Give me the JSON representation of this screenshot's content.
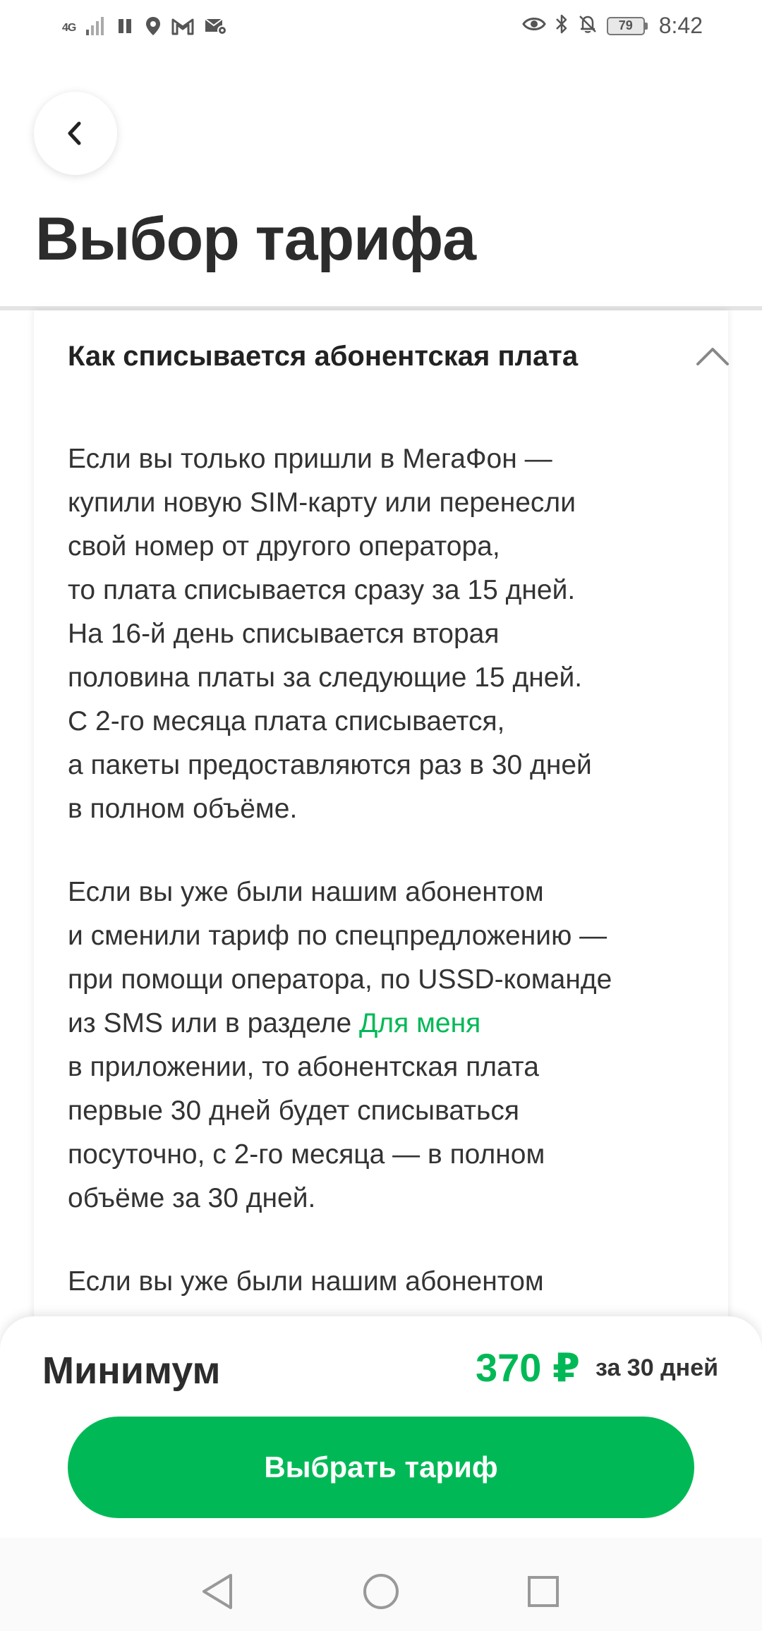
{
  "status_bar": {
    "network": "4G",
    "battery": "79",
    "time": "8:42"
  },
  "header": {
    "title": "Выбор тарифа"
  },
  "accordion": {
    "title": "Как списывается абонентская плата",
    "paragraphs": [
      {
        "lines": [
          "Если вы только пришли в МегаФон —",
          "купили новую SIM-карту или перенесли",
          "свой номер от другого оператора,",
          "то плата списывается сразу за 15 дней.",
          "На 16-й день списывается вторая",
          "половина платы за следующие 15 дней.",
          "С 2-го месяца плата списывается,",
          "а пакеты предоставляются раз в 30 дней",
          "в полном объёме."
        ]
      },
      {
        "lines_before_link": [
          "Если вы уже были нашим абонентом",
          "и сменили тариф по спецпредложению —",
          "при помощи оператора, по USSD-команде"
        ],
        "link_line_prefix": "из SMS или в разделе ",
        "link_text": "Для меня",
        "lines_after_link": [
          "в приложении, то абонентская плата",
          "первые 30 дней будет списываться",
          "посуточно, с 2-го месяца — в полном",
          "объёме за 30 дней."
        ]
      },
      {
        "lines": [
          "Если вы уже были нашим абонентом"
        ]
      }
    ]
  },
  "bottom_sheet": {
    "tariff_name": "Минимум",
    "price": "370 ₽",
    "period": "за 30 дней",
    "button_label": "Выбрать тариф"
  },
  "colors": {
    "accent": "#00b956",
    "text": "#2b2b2b"
  },
  "icons": [
    "signal-icon",
    "pause-icon",
    "location-icon",
    "gmail-icon",
    "mail-settings-icon",
    "eye-icon",
    "bluetooth-icon",
    "bell-off-icon",
    "battery-icon",
    "back-arrow-icon",
    "chevron-up-icon",
    "nav-back-icon",
    "nav-home-icon",
    "nav-recents-icon"
  ]
}
